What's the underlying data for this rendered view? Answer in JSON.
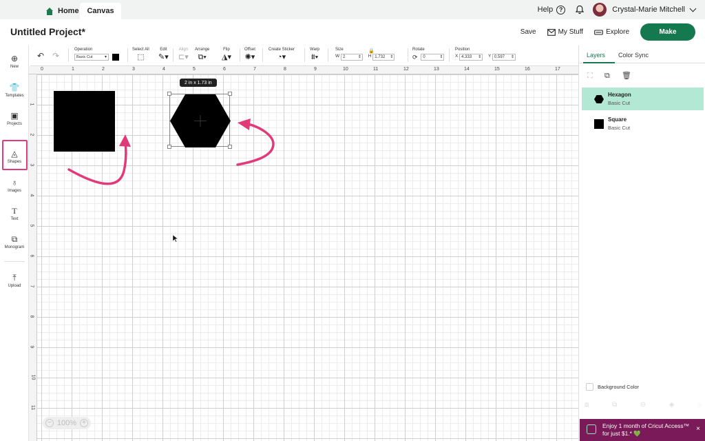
{
  "topbar": {
    "tabs": [
      {
        "label": "Home"
      },
      {
        "label": "Canvas"
      }
    ],
    "help_label": "Help",
    "help_glyph": "?",
    "user_name": "Crystal-Marie Mitchell"
  },
  "header": {
    "project_title": "Untitled Project*",
    "save_label": "Save",
    "mystuff_label": "My Stuff",
    "explore_label": "Explore",
    "make_label": "Make"
  },
  "toolbar": {
    "operation_label": "Operation",
    "operation_value": "Basic Cut",
    "select_all_label": "Select All",
    "edit_label": "Edit",
    "align_label": "Align",
    "arrange_label": "Arrange",
    "flip_label": "Flip",
    "offset_label": "Offset",
    "create_sticker_label": "Create Sticker",
    "warp_label": "Warp",
    "size_label": "Size",
    "width_prefix": "W",
    "width_value": "2",
    "height_prefix": "H",
    "height_value": "1.732",
    "rotate_label": "Rotate",
    "rotate_value": "0",
    "position_label": "Position",
    "x_prefix": "X",
    "x_value": "4.333",
    "y_prefix": "Y",
    "y_value": "0.597",
    "accent_color": "#000000"
  },
  "leftnav": {
    "items": [
      {
        "label": "New",
        "icon": "plus-circle-icon"
      },
      {
        "label": "Templates",
        "icon": "shirt-icon"
      },
      {
        "label": "Projects",
        "icon": "projects-icon"
      },
      {
        "label": "Shapes",
        "icon": "shapes-icon"
      },
      {
        "label": "Images",
        "icon": "lightbulb-icon"
      },
      {
        "label": "Text",
        "icon": "text-icon"
      },
      {
        "label": "Monogram",
        "icon": "monogram-icon"
      },
      {
        "label": "Upload",
        "icon": "upload-icon"
      }
    ],
    "highlight_color": "#e03a7a"
  },
  "canvas": {
    "ruler_top": [
      "0",
      "1",
      "2",
      "3",
      "4",
      "5",
      "6",
      "7",
      "8",
      "9",
      "10",
      "11",
      "12",
      "13",
      "14",
      "15",
      "16",
      "17"
    ],
    "ruler_left": [
      "1",
      "2",
      "3",
      "4",
      "5",
      "6",
      "7",
      "8",
      "9",
      "10",
      "11"
    ],
    "size_tooltip": "2  in x 1.73  in",
    "zoom_label": "100%",
    "zoom_minus": "−",
    "zoom_plus": "+",
    "arrow_color": "#e03a7a"
  },
  "rightpanel": {
    "tabs": [
      {
        "label": "Layers"
      },
      {
        "label": "Color Sync"
      }
    ],
    "layers": [
      {
        "name": "Hexagon",
        "sub": "Basic Cut",
        "selected": true
      },
      {
        "name": "Square",
        "sub": "Basic Cut",
        "selected": false
      }
    ],
    "background_color_label": "Background Color",
    "selected_color": "#b3e8d4",
    "accent_color": "#14794e"
  },
  "promo": {
    "line1": "Enjoy 1 month of Cricut Access™",
    "line2": "for just $1.* 💚",
    "close": "×"
  }
}
